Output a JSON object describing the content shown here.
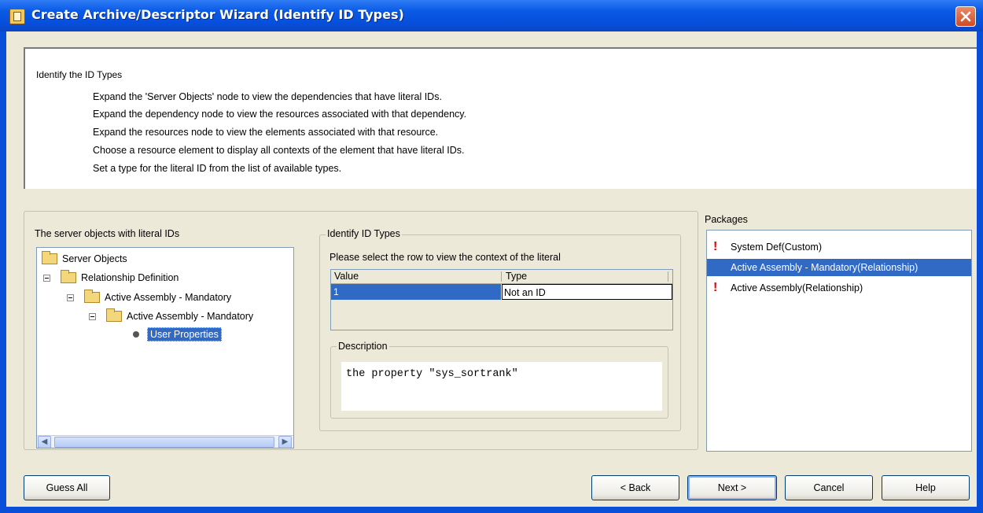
{
  "window": {
    "title": "Create Archive/Descriptor Wizard (Identify ID Types)"
  },
  "instructions": {
    "title": "Identify the ID Types",
    "lines": [
      "Expand the 'Server Objects' node to view the dependencies that have literal IDs.",
      "Expand the dependency node to view the resources associated with that dependency.",
      "Expand the resources node to view the elements associated with that resource.",
      "Choose a resource element to display all contexts of the element that have literal IDs.",
      "Set a type for the literal ID from the list of available types."
    ]
  },
  "server_objects": {
    "label": "The server objects with literal IDs",
    "tree": [
      {
        "label": "Server Objects"
      },
      {
        "label": "Relationship Definition"
      },
      {
        "label": "Active Assembly - Mandatory"
      },
      {
        "label": "Active Assembly - Mandatory"
      },
      {
        "label": "User Properties"
      }
    ]
  },
  "identify": {
    "group_label": "Identify ID Types",
    "prompt": "Please select the row to view the context of the literal",
    "columns": [
      "Value",
      "Type"
    ],
    "rows": [
      {
        "value": "1",
        "type": "Not an ID"
      }
    ],
    "description_label": "Description",
    "description_text": "the property \"sys_sortrank\""
  },
  "packages": {
    "label": "Packages",
    "items": [
      {
        "label": "System Def(Custom)",
        "flag": "!"
      },
      {
        "label": "Active Assembly - Mandatory(Relationship)",
        "flag": ""
      },
      {
        "label": "Active Assembly(Relationship)",
        "flag": "!"
      }
    ]
  },
  "buttons": {
    "guess_all": "Guess All",
    "back": "< Back",
    "next": "Next >",
    "cancel": "Cancel",
    "help": "Help"
  },
  "colors": {
    "title_bar": "#0a5ae6",
    "selection": "#316ac5",
    "warning": "#e00000",
    "dialog_bg": "#ece9d8"
  }
}
